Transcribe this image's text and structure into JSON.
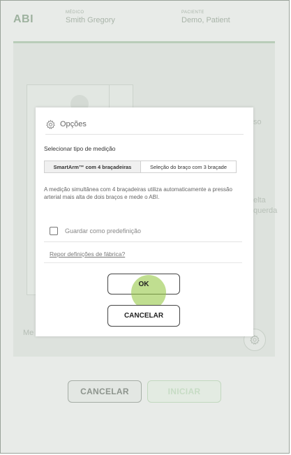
{
  "header": {
    "app_title": "ABI",
    "medico_label": "MÉDICO",
    "medico_value": "Smith Gregory",
    "patient_label": "PACIENTE",
    "patient_value": "Demo, Patient"
  },
  "background": {
    "side_text_1": "so",
    "side_text_2": "elta",
    "side_text_3": "querda",
    "bottom_text": "Me",
    "cancel_label": "CANCELAR",
    "start_label": "INICIAR"
  },
  "modal": {
    "title": "Opções",
    "measurement_label": "Selecionar tipo de medição",
    "options": [
      {
        "label": "SmartArm™ com 4 braçadeiras",
        "selected": true
      },
      {
        "label": "Seleção do braço com 3 braçade",
        "selected": false
      }
    ],
    "description": "A medição simultânea com 4 braçadeiras utiliza automaticamente a pressão arterial mais alta de dois braços e mede o ABI.",
    "save_default_label": "Guardar como predefinição",
    "reset_link": "Repor definições de fábrica?",
    "ok_label": "OK",
    "cancel_label": "CANCELAR"
  },
  "icons": {
    "modal_title_icon": "gear-icon",
    "bg_settings_icon": "gear-icon"
  },
  "colors": {
    "accent_green": "#9eb29f",
    "touch_indicator": "#96c846"
  }
}
